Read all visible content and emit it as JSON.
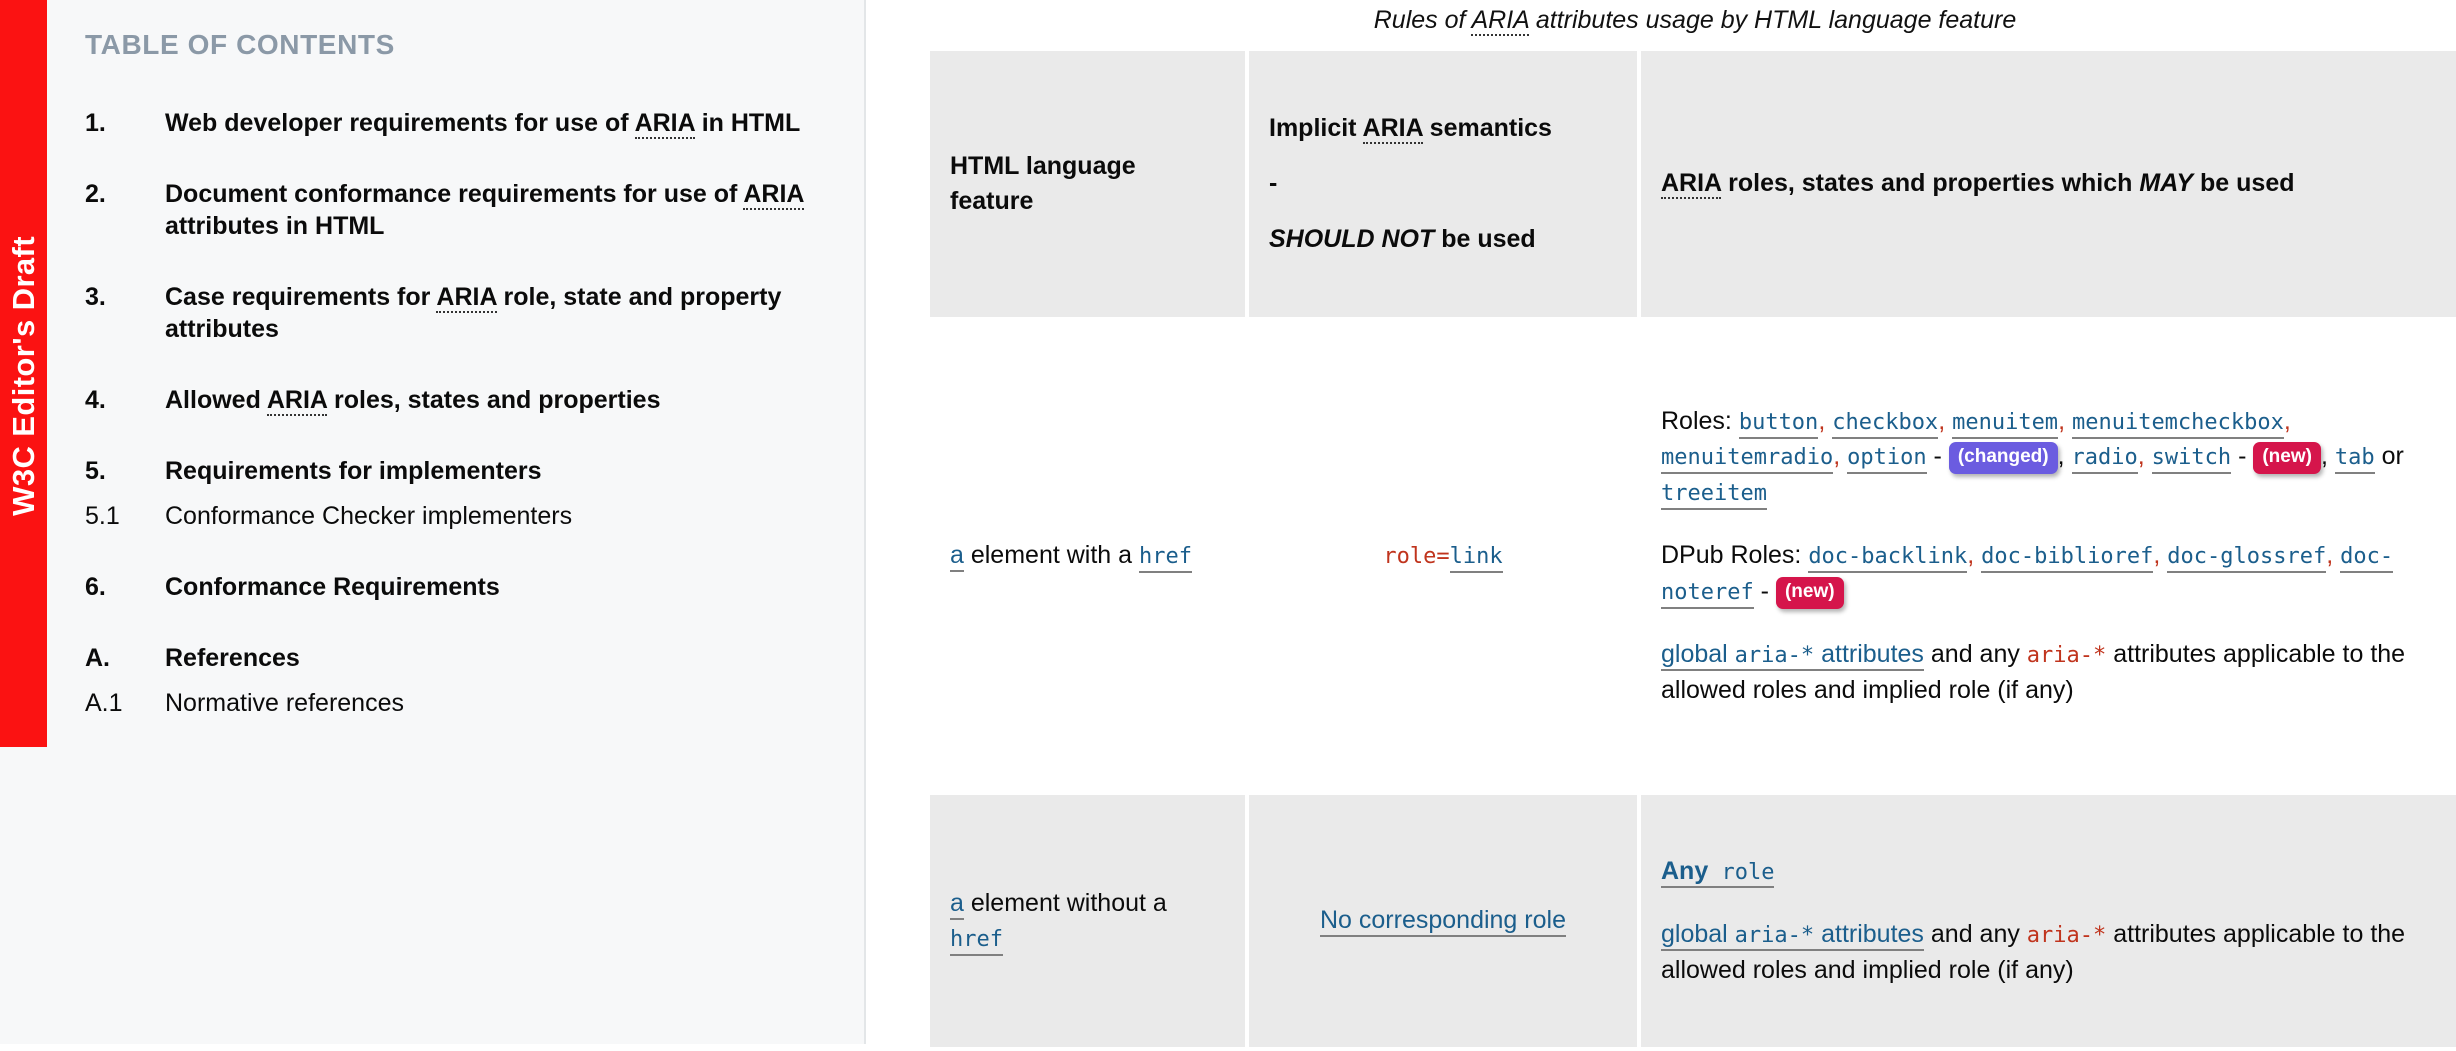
{
  "sidebar": {
    "status_label": "W3C Editor's Draft",
    "status_color": "#fb1212",
    "toc_title": "TABLE OF CONTENTS",
    "toc_title_color": "#8b99a7",
    "items": [
      {
        "num": "1.",
        "label": "Web developer requirements for use of ARIA in HTML",
        "level": 1
      },
      {
        "num": "2.",
        "label": "Document conformance requirements for use of ARIA attributes in HTML",
        "level": 1
      },
      {
        "num": "3.",
        "label": "Case requirements for ARIA role, state and property attributes",
        "level": 1
      },
      {
        "num": "4.",
        "label": "Allowed ARIA roles, states and properties",
        "level": 1
      },
      {
        "num": "5.",
        "label": "Requirements for implementers",
        "level": 1
      },
      {
        "num": "5.1",
        "label": "Conformance Checker implementers",
        "level": 2
      },
      {
        "num": "6.",
        "label": "Conformance Requirements",
        "level": 1
      },
      {
        "num": "A.",
        "label": "References",
        "level": 1
      },
      {
        "num": "A.1",
        "label": "Normative references",
        "level": 2
      }
    ]
  },
  "table": {
    "caption": "Rules of ARIA attributes usage by HTML language feature",
    "headers": {
      "col1": "HTML language feature",
      "col2_line1": "Implicit ARIA semantics",
      "col2_line2": "-",
      "col2_line3_em": "SHOULD NOT",
      "col2_line3_rest": " be used",
      "col3_pre": "ARIA roles, states and properties which ",
      "col3_em": "MAY",
      "col3_post": " be used"
    },
    "rows": [
      {
        "feature_link": "a",
        "feature_text": " element with a ",
        "feature_code": "href",
        "implicit_prefix": "role=",
        "implicit_link": "link",
        "roles_label": "Roles:",
        "roles": [
          {
            "name": "button",
            "sep": ","
          },
          {
            "name": "checkbox",
            "sep": ","
          },
          {
            "name": "menuitem",
            "sep": ","
          },
          {
            "name": "menuitemcheckbox",
            "sep": ","
          },
          {
            "name": "menuitemradio",
            "sep": ","
          },
          {
            "name": "option",
            "sep": " -",
            "badge": "(changed)",
            "badge_type": "changed",
            "after": ","
          },
          {
            "name": "radio",
            "sep": ","
          },
          {
            "name": "switch",
            "sep": " -",
            "badge": "(new)",
            "badge_type": "new",
            "after": ","
          },
          {
            "name": "tab",
            "sep": " or"
          },
          {
            "name": "treeitem",
            "sep": ""
          }
        ],
        "dpub_label": "DPub Roles:",
        "dpub_roles": [
          {
            "name": "doc-backlink",
            "sep": ","
          },
          {
            "name": "doc-biblioref",
            "sep": ","
          },
          {
            "name": "doc-glossref",
            "sep": ","
          },
          {
            "name": "doc-noteref",
            "sep": " -",
            "badge": "(new)",
            "badge_type": "new"
          }
        ],
        "global_link_pre": "global ",
        "global_link_code": "aria-*",
        "global_link_post": " attributes",
        "global_mid": " and any ",
        "global_code": "aria-*",
        "global_tail": " attributes applicable to the allowed roles and implied role (if any)"
      },
      {
        "feature_link": "a",
        "feature_text": " element without a ",
        "feature_code": "href",
        "implicit_text": "No corresponding role",
        "any_role_bold": "Any",
        "any_role_code": " role",
        "global_link_pre": "global ",
        "global_link_code": "aria-*",
        "global_link_post": " attributes",
        "global_mid": " and any ",
        "global_code": "aria-*",
        "global_tail": " attributes applicable to the allowed roles and implied role (if any)"
      }
    ]
  },
  "colors": {
    "link": "#1b5e8c",
    "code_red": "#c0341d",
    "badge_new": "#d5154b",
    "badge_changed": "#6b5ce0",
    "header_bg": "#eaeaea",
    "sidebar_bg": "#f7f8f9"
  }
}
